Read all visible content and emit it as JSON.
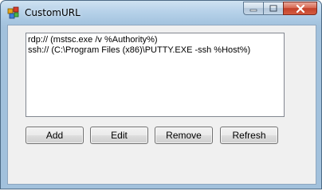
{
  "window": {
    "title": "CustomURL",
    "caption_buttons": [
      "minimize-icon",
      "maximize-icon",
      "close-icon"
    ]
  },
  "list": {
    "items": [
      "rdp:// (mstsc.exe /v %Authority%)",
      "ssh:// (C:\\Program Files (x86)\\PUTTY.EXE -ssh %Host%)"
    ]
  },
  "buttons": {
    "add": "Add",
    "edit": "Edit",
    "remove": "Remove",
    "refresh": "Refresh"
  },
  "colors": {
    "title_bar": "#a7c6e1",
    "close_button": "#c3412a",
    "client_background": "#f0f0f0"
  }
}
